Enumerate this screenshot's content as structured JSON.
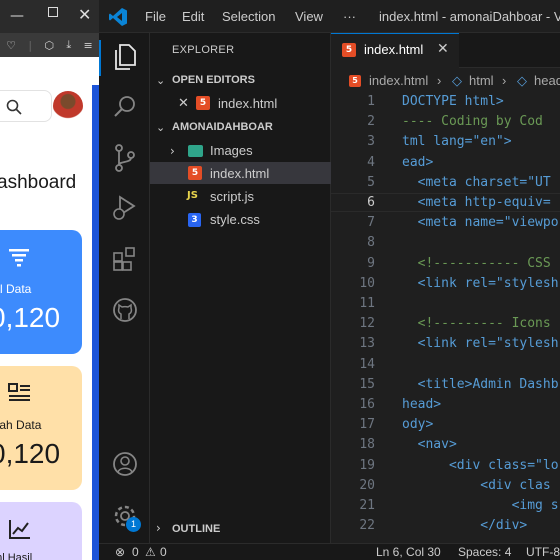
{
  "browser": {
    "dashboard_title": "ashboard",
    "cards": [
      {
        "label": "tal Data",
        "value": "0,120"
      },
      {
        "label": "nlah Data",
        "value": "0,120"
      },
      {
        "label": "ahl Hasil",
        "value": ""
      }
    ],
    "colors": {
      "card_blue": "#3d8bfd",
      "card_yellow": "#ffe0a8",
      "card_purple": "#dcd3ff",
      "scroll_strip": "#1c54d8"
    }
  },
  "titlebar": {
    "menus": [
      "File",
      "Edit",
      "Selection",
      "View"
    ],
    "more": "···",
    "window_title": "index.html - amonaiDahboar - Visu"
  },
  "sidebar": {
    "explorer_title": "EXPLORER",
    "open_editors_label": "OPEN EDITORS",
    "open_editor_file": "index.html",
    "project_label": "AMONAIDAHBOAR",
    "tree": [
      {
        "name": "Images",
        "type": "folder"
      },
      {
        "name": "index.html",
        "type": "html"
      },
      {
        "name": "script.js",
        "type": "js"
      },
      {
        "name": "style.css",
        "type": "css"
      }
    ],
    "outline_label": "OUTLINE"
  },
  "activity": {
    "badge_count": "1"
  },
  "tab": {
    "label": "index.html"
  },
  "breadcrumb": {
    "file": "index.html",
    "html": "html",
    "head": "head"
  },
  "editor": {
    "lines": [
      {
        "num": "1",
        "text": "DOCTYPE html>"
      },
      {
        "num": "2",
        "text": "---- Coding by Cod"
      },
      {
        "num": "3",
        "text": "tml lang=\"en\">"
      },
      {
        "num": "4",
        "text": "ead>"
      },
      {
        "num": "5",
        "text": "  <meta charset=\"UT"
      },
      {
        "num": "6",
        "text": "  <meta http-equiv="
      },
      {
        "num": "7",
        "text": "  <meta name=\"viewpo"
      },
      {
        "num": "8",
        "text": ""
      },
      {
        "num": "9",
        "text": "  <!----------- CSS"
      },
      {
        "num": "10",
        "text": "  <link rel=\"stylesh"
      },
      {
        "num": "11",
        "text": ""
      },
      {
        "num": "12",
        "text": "  <!--------- Icons"
      },
      {
        "num": "13",
        "text": "  <link rel=\"stylesh"
      },
      {
        "num": "14",
        "text": ""
      },
      {
        "num": "15",
        "text": "  <title>Admin Dashb"
      },
      {
        "num": "16",
        "text": "head>"
      },
      {
        "num": "17",
        "text": "ody>"
      },
      {
        "num": "18",
        "text": "  <nav>"
      },
      {
        "num": "19",
        "text": "      <div class=\"lo"
      },
      {
        "num": "20",
        "text": "          <div clas"
      },
      {
        "num": "21",
        "text": "              <img s"
      },
      {
        "num": "22",
        "text": "          </div>"
      }
    ]
  },
  "statusbar": {
    "problems": "0",
    "warnings": "0",
    "position": "Ln 6, Col 30",
    "spaces": "Spaces: 4",
    "encoding": "UTF-8"
  }
}
